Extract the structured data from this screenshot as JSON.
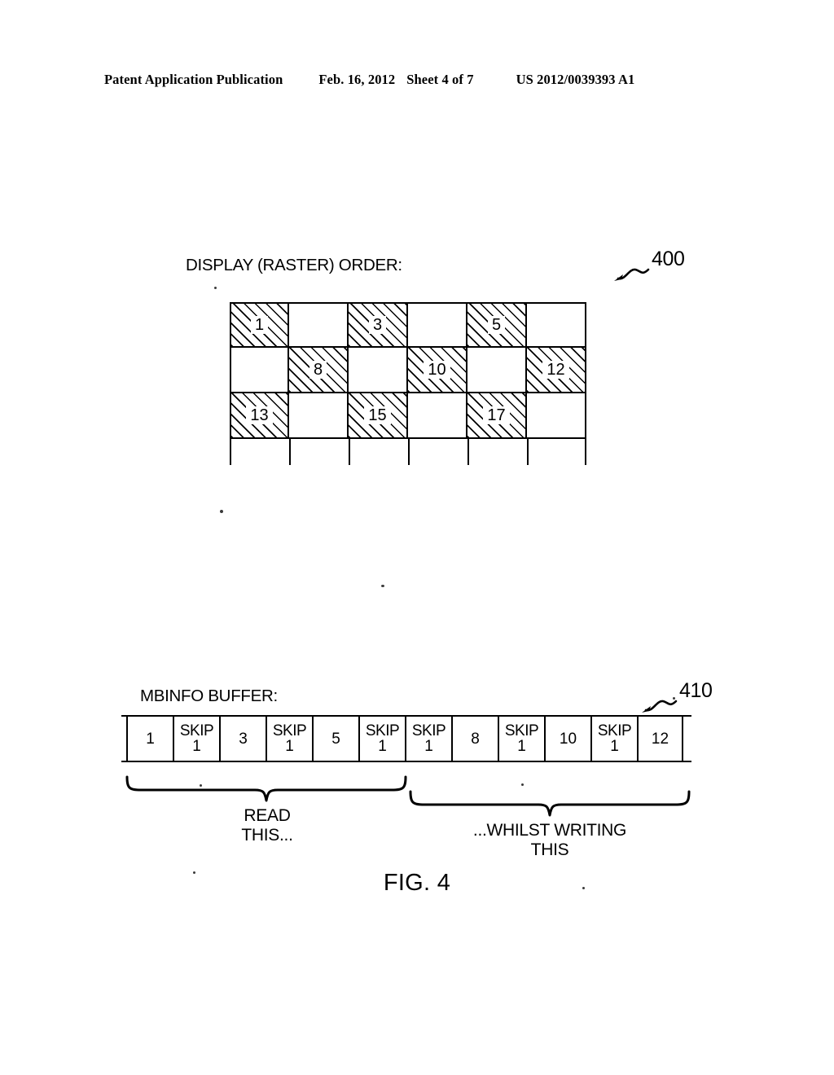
{
  "header": {
    "publication": "Patent Application Publication",
    "date": "Feb. 16, 2012",
    "sheet": "Sheet 4 of 7",
    "document_number": "US 2012/0039393 A1"
  },
  "figure": {
    "caption": "FIG. 4"
  },
  "raster_section": {
    "label": "DISPLAY (RASTER) ORDER:",
    "ref_numeral": "400",
    "grid": {
      "columns": 6,
      "rows": 3,
      "cells": [
        [
          {
            "value": "1",
            "hatched": true
          },
          {
            "value": "",
            "hatched": false
          },
          {
            "value": "3",
            "hatched": true
          },
          {
            "value": "",
            "hatched": false
          },
          {
            "value": "5",
            "hatched": true
          },
          {
            "value": "",
            "hatched": false
          }
        ],
        [
          {
            "value": "",
            "hatched": false
          },
          {
            "value": "8",
            "hatched": true
          },
          {
            "value": "",
            "hatched": false
          },
          {
            "value": "10",
            "hatched": true
          },
          {
            "value": "",
            "hatched": false
          },
          {
            "value": "12",
            "hatched": true
          }
        ],
        [
          {
            "value": "13",
            "hatched": true
          },
          {
            "value": "",
            "hatched": false
          },
          {
            "value": "15",
            "hatched": true
          },
          {
            "value": "",
            "hatched": false
          },
          {
            "value": "17",
            "hatched": true
          },
          {
            "value": "",
            "hatched": false
          }
        ]
      ]
    }
  },
  "buffer_section": {
    "label": "MBINFO BUFFER:",
    "ref_numeral": "410",
    "cells": [
      {
        "type": "data",
        "value": "1",
        "hatched": true
      },
      {
        "type": "skip",
        "word": "SKIP",
        "value": "1",
        "hatched": false
      },
      {
        "type": "data",
        "value": "3",
        "hatched": true
      },
      {
        "type": "skip",
        "word": "SKIP",
        "value": "1",
        "hatched": false
      },
      {
        "type": "data",
        "value": "5",
        "hatched": true
      },
      {
        "type": "skip",
        "word": "SKIP",
        "value": "1",
        "hatched": false
      },
      {
        "type": "skip",
        "word": "SKIP",
        "value": "1",
        "hatched": false
      },
      {
        "type": "data",
        "value": "8",
        "hatched": true
      },
      {
        "type": "skip",
        "word": "SKIP",
        "value": "1",
        "hatched": false
      },
      {
        "type": "data",
        "value": "10",
        "hatched": true
      },
      {
        "type": "skip",
        "word": "SKIP",
        "value": "1",
        "hatched": false
      },
      {
        "type": "data",
        "value": "12",
        "hatched": true
      }
    ],
    "annotations": {
      "read": {
        "line1": "READ",
        "line2": "THIS..."
      },
      "write": {
        "line1": "...WHILST WRITING",
        "line2": "THIS"
      }
    }
  }
}
